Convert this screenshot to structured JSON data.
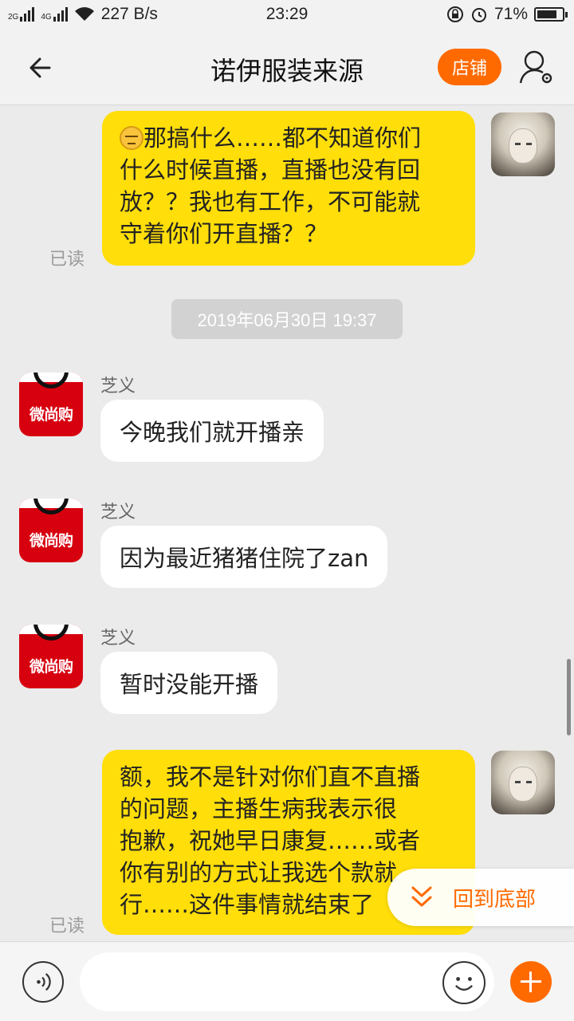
{
  "status_bar": {
    "net_speed": "227 B/s",
    "time": "23:29",
    "battery": "71%",
    "battery_level": 0.71,
    "sim_labels": [
      "2G",
      "4G"
    ]
  },
  "header": {
    "title": "诺伊服装来源",
    "shop_button": "店铺"
  },
  "messages": [
    {
      "side": "out",
      "text_lines": [
        "那搞什么……都不知道你们",
        "什么时候直播，直播也没有回",
        "放？？我也有工作，不可能就",
        "守着你们开直播？？"
      ],
      "read": "已读"
    },
    {
      "side": "time",
      "text": "2019年06月30日 19:37"
    },
    {
      "side": "in",
      "sender": "芝义",
      "text": "今晚我们就开播亲"
    },
    {
      "side": "in",
      "sender": "芝义",
      "text": "因为最近猪猪住院了zan"
    },
    {
      "side": "in",
      "sender": "芝义",
      "text": "暂时没能开播"
    },
    {
      "side": "out",
      "text_lines": [
        "额，我不是针对你们直不直播",
        "的问题，主播生病我表示很",
        "抱歉，祝她早日康复……或者",
        "你有别的方式让我选个款就",
        "行……这件事情就结束了"
      ],
      "read": "已读"
    }
  ],
  "shop_avatar_brand": "微尚购",
  "scroll_to_bottom": "回到底部",
  "colors": {
    "accent": "#ff6a00",
    "outgoing_bubble": "#ffde0a",
    "incoming_bubble": "#ffffff",
    "background": "#ebebeb"
  },
  "icons": [
    "back-arrow-icon",
    "profile-settings-icon",
    "voice-icon",
    "emoji-icon",
    "plus-icon",
    "double-chevron-down-icon"
  ]
}
